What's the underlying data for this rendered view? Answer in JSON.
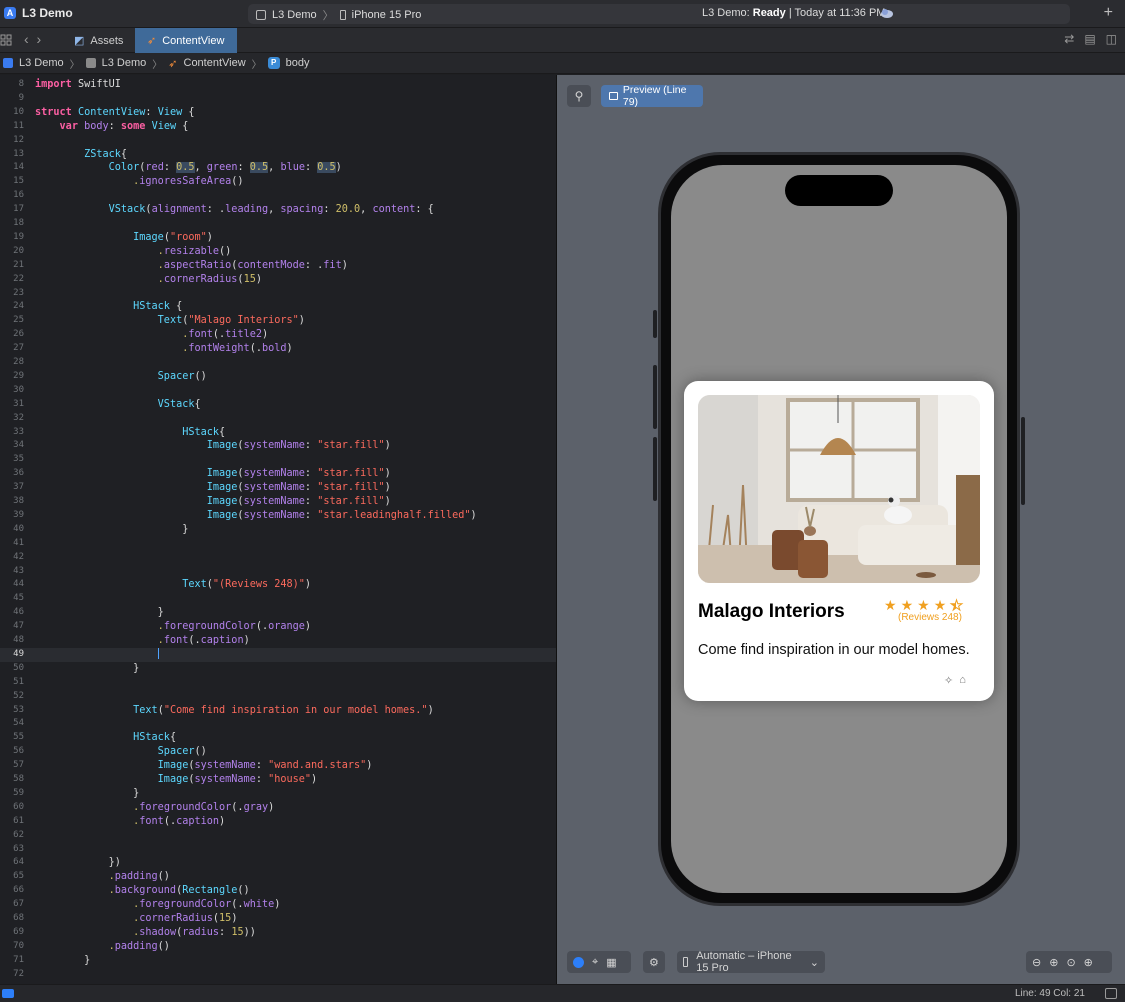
{
  "titlebar": {
    "app_name": "L3 Demo",
    "scheme": "L3 Demo",
    "device": "iPhone 15 Pro",
    "status_prefix": "L3 Demo: ",
    "status_state": "Ready",
    "status_suffix": " | Today at 11:36 PM"
  },
  "tabs": [
    {
      "label": "Assets"
    },
    {
      "label": "ContentView"
    }
  ],
  "breadcrumb": [
    "L3 Demo",
    "L3 Demo",
    "ContentView",
    "body"
  ],
  "editor": {
    "current_line": 49,
    "lines": [
      {
        "n": "8"
      },
      {
        "n": "9"
      },
      {
        "n": "10"
      },
      {
        "n": "11"
      },
      {
        "n": "12"
      },
      {
        "n": "13"
      },
      {
        "n": "14"
      },
      {
        "n": "15"
      },
      {
        "n": "16"
      },
      {
        "n": "17"
      },
      {
        "n": "18"
      },
      {
        "n": "19"
      },
      {
        "n": "20"
      },
      {
        "n": "21"
      },
      {
        "n": "22"
      },
      {
        "n": "23"
      },
      {
        "n": "24"
      },
      {
        "n": "25"
      },
      {
        "n": "26"
      },
      {
        "n": "27"
      },
      {
        "n": "28"
      },
      {
        "n": "29"
      },
      {
        "n": "30"
      },
      {
        "n": "31"
      },
      {
        "n": "32"
      },
      {
        "n": "33"
      },
      {
        "n": "34"
      },
      {
        "n": "35"
      },
      {
        "n": "36"
      },
      {
        "n": "37"
      },
      {
        "n": "38"
      },
      {
        "n": "39"
      },
      {
        "n": "40"
      },
      {
        "n": "41"
      },
      {
        "n": "42"
      },
      {
        "n": "43"
      },
      {
        "n": "44"
      },
      {
        "n": "45"
      },
      {
        "n": "46"
      },
      {
        "n": "47"
      },
      {
        "n": "48"
      },
      {
        "n": "49"
      },
      {
        "n": "50"
      },
      {
        "n": "51"
      },
      {
        "n": "52"
      },
      {
        "n": "53"
      },
      {
        "n": "54"
      },
      {
        "n": "55"
      },
      {
        "n": "56"
      },
      {
        "n": "57"
      },
      {
        "n": "58"
      },
      {
        "n": "59"
      },
      {
        "n": "60"
      },
      {
        "n": "61"
      },
      {
        "n": "62"
      },
      {
        "n": "63"
      },
      {
        "n": "64"
      },
      {
        "n": "65"
      },
      {
        "n": "66"
      },
      {
        "n": "67"
      },
      {
        "n": "68"
      },
      {
        "n": "69"
      },
      {
        "n": "70"
      },
      {
        "n": "71"
      },
      {
        "n": "72"
      }
    ],
    "code": {
      "l8": [
        "import",
        " SwiftUI"
      ],
      "l10": [
        "struct",
        " ContentView",
        ": ",
        "View",
        " {"
      ],
      "l11": [
        "    ",
        "var",
        " body",
        ": ",
        "some",
        " ",
        "View",
        " {"
      ],
      "l13": [
        "        ",
        "ZStack",
        "{"
      ],
      "l14": [
        "            ",
        "Color",
        "(",
        "red",
        ": ",
        "0.5",
        ", ",
        "green",
        ": ",
        "0.5",
        ", ",
        "blue",
        ": ",
        "0.5",
        ")"
      ],
      "l15": [
        "                .",
        "ignoresSafeArea",
        "()"
      ],
      "l17": [
        "            ",
        "VStack",
        "(",
        "alignment",
        ": .",
        "leading",
        ", ",
        "spacing",
        ": ",
        "20.0",
        ", ",
        "content",
        ": {"
      ],
      "l19": [
        "                ",
        "Image",
        "(",
        "\"room\"",
        ")"
      ],
      "l20": [
        "                    .",
        "resizable",
        "()"
      ],
      "l21": [
        "                    .",
        "aspectRatio",
        "(",
        "contentMode",
        ": .",
        "fit",
        ")"
      ],
      "l22": [
        "                    .",
        "cornerRadius",
        "(",
        "15",
        ")"
      ],
      "l24": [
        "                ",
        "HStack",
        " {"
      ],
      "l25": [
        "                    ",
        "Text",
        "(",
        "\"Malago Interiors\"",
        ")"
      ],
      "l26": [
        "                        .",
        "font",
        "(.",
        "title2",
        ")"
      ],
      "l27": [
        "                        .",
        "fontWeight",
        "(.",
        "bold",
        ")"
      ],
      "l29": [
        "                    ",
        "Spacer",
        "()"
      ],
      "l31": [
        "                    ",
        "VStack",
        "{"
      ],
      "l33": [
        "                        ",
        "HStack",
        "{"
      ],
      "l34": [
        "                            ",
        "Image",
        "(",
        "systemName",
        ": ",
        "\"star.fill\"",
        ")"
      ],
      "l36": [
        "                            ",
        "Image",
        "(",
        "systemName",
        ": ",
        "\"star.fill\"",
        ")"
      ],
      "l37": [
        "                            ",
        "Image",
        "(",
        "systemName",
        ": ",
        "\"star.fill\"",
        ")"
      ],
      "l38": [
        "                            ",
        "Image",
        "(",
        "systemName",
        ": ",
        "\"star.fill\"",
        ")"
      ],
      "l39": [
        "                            ",
        "Image",
        "(",
        "systemName",
        ": ",
        "\"star.leadinghalf.filled\"",
        ")"
      ],
      "l40": [
        "                        }"
      ],
      "l44": [
        "                        ",
        "Text",
        "(",
        "\"(Reviews 248)\"",
        ")"
      ],
      "l46": [
        "                    }"
      ],
      "l47": [
        "                    .",
        "foregroundColor",
        "(.",
        "orange",
        ")"
      ],
      "l48": [
        "                    .",
        "font",
        "(.",
        "caption",
        ")"
      ],
      "l50": [
        "                }"
      ],
      "l53": [
        "                ",
        "Text",
        "(",
        "\"Come find inspiration in our model homes.\"",
        ")"
      ],
      "l55": [
        "                ",
        "HStack",
        "{"
      ],
      "l56": [
        "                    ",
        "Spacer",
        "()"
      ],
      "l57": [
        "                    ",
        "Image",
        "(",
        "systemName",
        ": ",
        "\"wand.and.stars\"",
        ")"
      ],
      "l58": [
        "                    ",
        "Image",
        "(",
        "systemName",
        ": ",
        "\"house\"",
        ")"
      ],
      "l59": [
        "                }"
      ],
      "l60": [
        "                .",
        "foregroundColor",
        "(.",
        "gray",
        ")"
      ],
      "l61": [
        "                .",
        "font",
        "(.",
        "caption",
        ")"
      ],
      "l64": [
        "            })"
      ],
      "l65": [
        "            .",
        "padding",
        "()"
      ],
      "l66": [
        "            .",
        "background",
        "(",
        "Rectangle",
        "()"
      ],
      "l67": [
        "                .",
        "foregroundColor",
        "(.",
        "white",
        ")"
      ],
      "l68": [
        "                .",
        "cornerRadius",
        "(",
        "15",
        ")"
      ],
      "l69": [
        "                .",
        "shadow",
        "(",
        "radius",
        ": ",
        "15",
        "))"
      ],
      "l70": [
        "            .",
        "padding",
        "()"
      ],
      "l71": [
        "        }"
      ]
    }
  },
  "canvas": {
    "preview_label": "Preview (Line 79)",
    "device_selector": "Automatic – iPhone 15 Pro"
  },
  "card": {
    "title": "Malago Interiors",
    "rating_stars": 4.5,
    "reviews": "(Reviews 248)",
    "description": "Come find inspiration in our model homes."
  },
  "status": {
    "position": "Line: 49  Col: 21"
  },
  "colors": {
    "accent": "#2d7ff9",
    "star": "#f0a020",
    "active_tab": "#3f6a99"
  }
}
